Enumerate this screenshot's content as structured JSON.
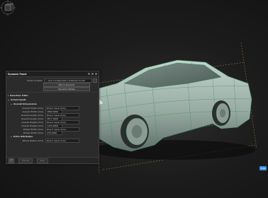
{
  "panel": {
    "title": "Dynamic Panel",
    "script_location_label": "Script Location",
    "script_location_value": ".../Car Configuration 2/Vehicle Script",
    "edit_button": "Edit in Dynamo",
    "autorun_button": "Dynamic Nodes",
    "selection_filter": "Selection Filter",
    "script_inputs": "Script Inputs",
    "overall_dimensions": "Overall Dimensions",
    "fields": [
      {
        "label": "Overall Width (mm)",
        "value": "Direct input (mm)"
      },
      {
        "label": "Overall Width (mm)",
        "value": "1860.0000"
      },
      {
        "label": "Overall Length (mm)",
        "value": "Direct input (mm)"
      },
      {
        "label": "Overall Length (mm)",
        "value": "4877.0000"
      },
      {
        "label": "Overall Height (mm)",
        "value": "Direct input (mm)"
      },
      {
        "label": "Overall Height (mm)",
        "value": "1470.0000"
      },
      {
        "label": "Wheel Width (mm)",
        "value": "Direct input (mm)"
      },
      {
        "label": "Wheel Width (mm)",
        "value": "235.0000"
      }
    ],
    "extra_section": "Extra Attributes",
    "wheel_radius_label": "Wheel Radius (mm)",
    "wheel_radius_value": "Direct input (mm)",
    "footer_cancel": "Cancel",
    "footer_run": "Run"
  },
  "help_button": "Help",
  "icons": {
    "refresh": "refresh-icon",
    "nav_cube": "nav-cube-icon"
  },
  "colors": {
    "car_body": "#a9bdb5",
    "wire_edges": "#2f8a5a",
    "accent": "#3d8fe0"
  }
}
